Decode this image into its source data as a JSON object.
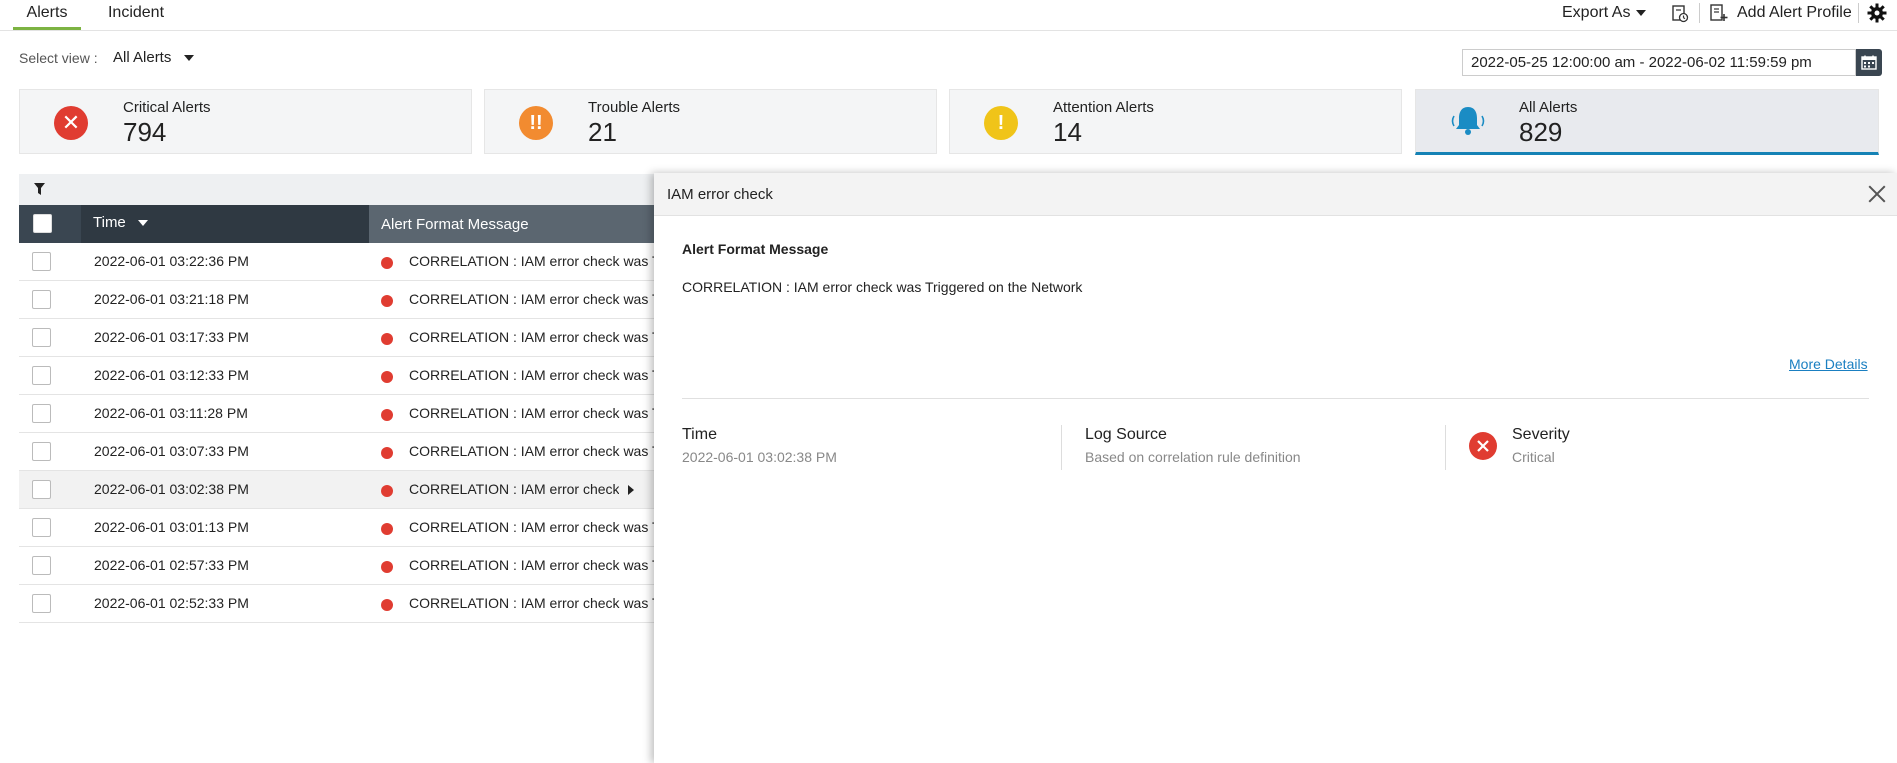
{
  "tabs": [
    {
      "label": "Alerts",
      "active": true
    },
    {
      "label": "Incident",
      "active": false
    }
  ],
  "toolbar": {
    "export_label": "Export As",
    "add_profile_label": "Add Alert Profile"
  },
  "view": {
    "label": "Select view :",
    "value": "All Alerts"
  },
  "date_range": "2022-05-25 12:00:00 am - 2022-06-02 11:59:59 pm",
  "cards": [
    {
      "label": "Critical Alerts",
      "count": "794",
      "color": "#e03c31",
      "icon": "critical-icon"
    },
    {
      "label": "Trouble Alerts",
      "count": "21",
      "color": "#f28b30",
      "icon": "trouble-icon"
    },
    {
      "label": "Attention Alerts",
      "count": "14",
      "color": "#f0c419",
      "icon": "attention-icon"
    },
    {
      "label": "All Alerts",
      "count": "829",
      "color": "#1582b5",
      "icon": "bell-icon"
    }
  ],
  "table": {
    "columns": [
      "Time",
      "Alert Format Message"
    ],
    "rows": [
      {
        "time": "2022-06-01 03:22:36 PM",
        "message": "CORRELATION : IAM error check was T"
      },
      {
        "time": "2022-06-01 03:21:18 PM",
        "message": "CORRELATION : IAM error check was T"
      },
      {
        "time": "2022-06-01 03:17:33 PM",
        "message": "CORRELATION : IAM error check was T"
      },
      {
        "time": "2022-06-01 03:12:33 PM",
        "message": "CORRELATION : IAM error check was T"
      },
      {
        "time": "2022-06-01 03:11:28 PM",
        "message": "CORRELATION : IAM error check was T"
      },
      {
        "time": "2022-06-01 03:07:33 PM",
        "message": "CORRELATION : IAM error check was T"
      },
      {
        "time": "2022-06-01 03:02:38 PM",
        "message": "CORRELATION : IAM error check '"
      },
      {
        "time": "2022-06-01 03:01:13 PM",
        "message": "CORRELATION : IAM error check was T"
      },
      {
        "time": "2022-06-01 02:57:33 PM",
        "message": "CORRELATION : IAM error check was T"
      },
      {
        "time": "2022-06-01 02:52:33 PM",
        "message": "CORRELATION : IAM error check was T"
      }
    ]
  },
  "detail": {
    "title": "IAM error check",
    "afm_label": "Alert Format Message",
    "afm_value": "CORRELATION : IAM error check was Triggered on the Network",
    "more_details": "More Details",
    "time_label": "Time",
    "time_value": "2022-06-01 03:02:38 PM",
    "source_label": "Log Source",
    "source_value": "Based on correlation rule definition",
    "severity_label": "Severity",
    "severity_value": "Critical"
  }
}
